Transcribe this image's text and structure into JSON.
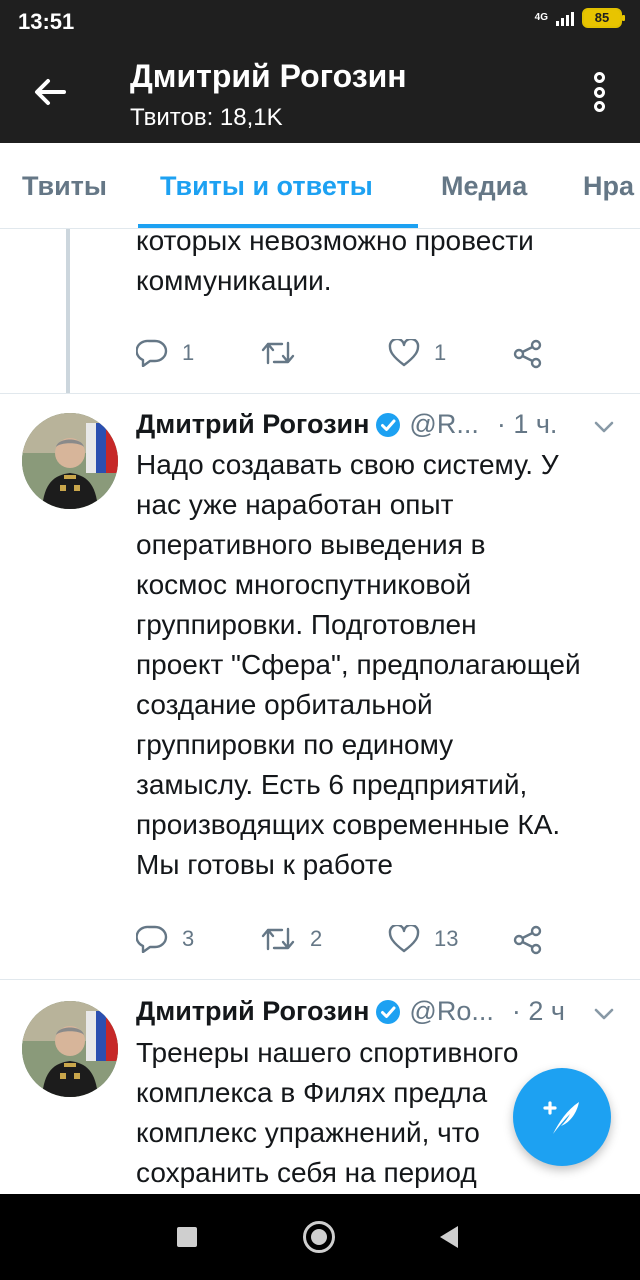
{
  "status_bar": {
    "time": "13:51",
    "network": "4G",
    "battery": "85"
  },
  "header": {
    "title": "Дмитрий Рогозин",
    "subtitle": "Твитов: 18,1K"
  },
  "tabs": [
    {
      "label": "Твиты",
      "active": false
    },
    {
      "label": "Твиты и ответы",
      "active": true
    },
    {
      "label": "Медиа",
      "active": false
    },
    {
      "label": "Нра",
      "active": false
    }
  ],
  "tweets": [
    {
      "lines": [
        "которых невозможно провести",
        "коммуникации."
      ],
      "replies": "1",
      "retweets": "",
      "likes": "1"
    },
    {
      "name": "Дмитрий Рогозин",
      "handle": "@R...",
      "time": "· 1 ч.",
      "lines": [
        "Надо создавать свою систему. У",
        "нас уже наработан опыт",
        "оперативного выведения в",
        "космос многоспутниковой",
        "группировки. Подготовлен",
        "проект \"Сфера\", предполагающей",
        "создание орбитальной",
        "группировки по единому",
        "замыслу. Есть 6 предприятий,",
        "производящих современные КА.",
        "Мы готовы к работе"
      ],
      "replies": "3",
      "retweets": "2",
      "likes": "13"
    },
    {
      "name": "Дмитрий Рогозин",
      "handle": "@Ro...",
      "time": "· 2 ч",
      "lines": [
        "Тренеры нашего спортивного",
        "комплекса в Филях предла",
        "комплекс упражнений, что",
        "сохранить себя на период"
      ]
    }
  ],
  "colors": {
    "accent": "#1da1f2",
    "header_bg": "#1f1f1f",
    "muted": "#657786"
  },
  "icons": [
    "back-arrow-icon",
    "more-vertical-icon",
    "reply-icon",
    "retweet-icon",
    "like-icon",
    "share-icon",
    "verified-icon",
    "chevron-down-icon",
    "compose-icon"
  ]
}
